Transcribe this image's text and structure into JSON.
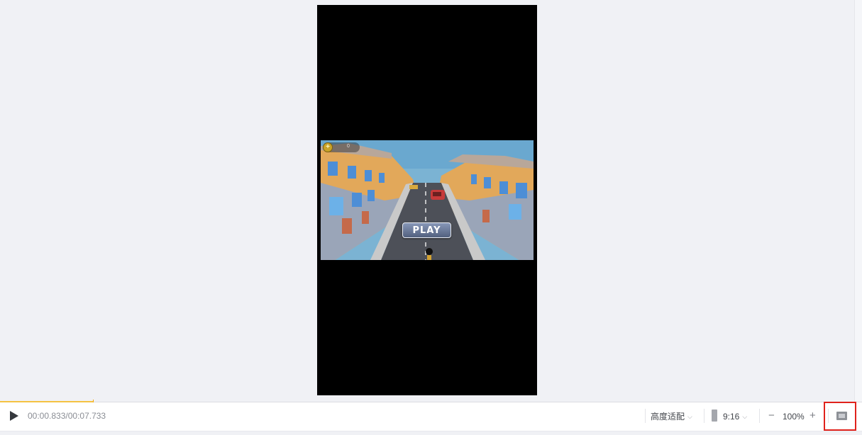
{
  "player": {
    "time_current": "00:00.833",
    "time_total": "00:07.733",
    "time_display": "00:00.833/00:07.733",
    "progress_fraction": 0.1077
  },
  "game": {
    "play_label": "PLAY",
    "coin_count": "0"
  },
  "toolbar": {
    "fit_mode_label": "高度适配",
    "aspect_ratio_label": "9:16",
    "zoom_label": "100%",
    "zoom_minus_icon": "minus-icon",
    "zoom_plus_icon": "plus-icon",
    "fullscreen_icon": "fullscreen-icon"
  },
  "colors": {
    "accent": "#f5c242",
    "highlight_box": "#e0221c"
  }
}
